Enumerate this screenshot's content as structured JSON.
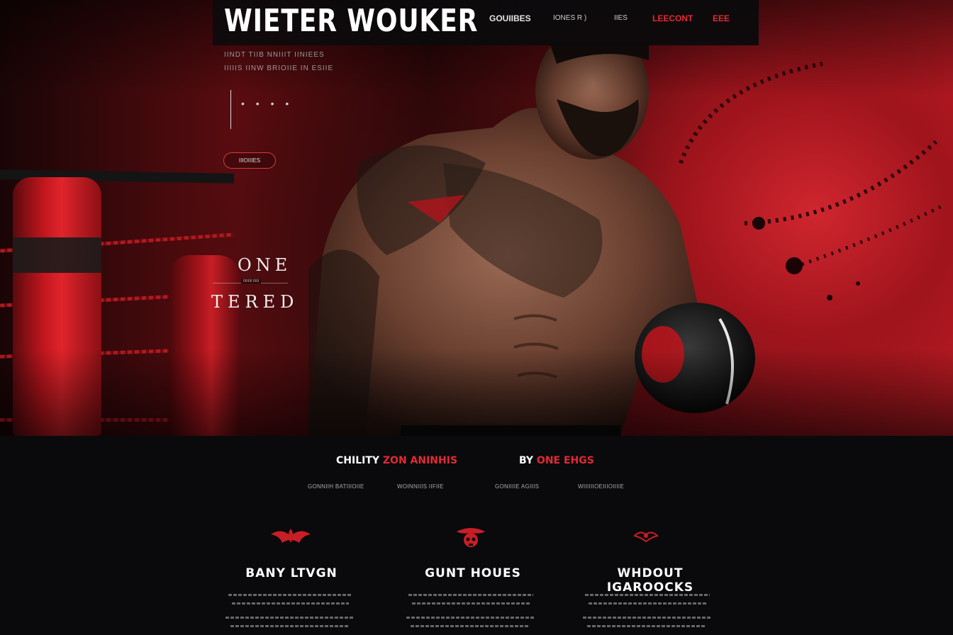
{
  "brand": {
    "logo": "WIETER WOUKER"
  },
  "nav": [
    {
      "label": "GOUIIBES",
      "active": false
    },
    {
      "label": "IONES R )",
      "active": false
    },
    {
      "label": "IIES",
      "active": false
    },
    {
      "label": "LEECONT",
      "active": true
    },
    {
      "label": "EEE",
      "active": true
    }
  ],
  "hero": {
    "tagline_1": "IINDT TIIB NNIIIT IINIEES",
    "tagline_2": "IIIIIS IINW BRIOIIE IN ESIIE",
    "dots": "• • • •",
    "button_label": "IIIOIIIES",
    "word_top": "ONE",
    "word_divider": "IIIIIIIII IIIIII",
    "word_bottom": "TERED"
  },
  "section": {
    "heading_left_white": "CHILITY",
    "heading_left_red": "ZON ANINHIS",
    "heading_right_white": "BY",
    "heading_right_red": "ONE EHGS",
    "subs": [
      "GONNIIH BATIIIOIIE",
      "WOINNIIIS IIFIIE",
      "GONIIIIE AGIIIS",
      "WIIIIIIOEIIIOIIIIE"
    ]
  },
  "features": [
    {
      "title": "BANY LTVGN",
      "icon": "winged-emblem-icon"
    },
    {
      "title": "GUNT HOUES",
      "icon": "skull-crest-icon"
    },
    {
      "title": "WHDOUT IGAROOCKS",
      "icon": "small-emblem-icon"
    }
  ],
  "colors": {
    "accent": "#e32a33",
    "background": "#0b0b0d",
    "hero_red": "#b81a22"
  }
}
